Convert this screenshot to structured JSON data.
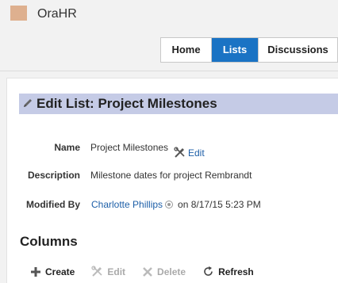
{
  "app": {
    "title": "OraHR",
    "logo_color": "#deb08f"
  },
  "nav": {
    "tabs": [
      {
        "label": "Home",
        "active": false
      },
      {
        "label": "Lists",
        "active": true
      },
      {
        "label": "Discussions",
        "active": false
      }
    ],
    "active_color": "#1a73c4"
  },
  "page": {
    "title": "Edit List: Project Milestones",
    "fields": {
      "name": {
        "label": "Name",
        "value": "Project Milestones",
        "edit_label": "Edit"
      },
      "description": {
        "label": "Description",
        "value": "Milestone dates for project Rembrandt"
      },
      "modified_by": {
        "label": "Modified By",
        "user": "Charlotte Phillips",
        "date": "on 8/17/15 5:23 PM"
      }
    }
  },
  "columns": {
    "heading": "Columns",
    "toolbar": {
      "create": "Create",
      "edit": "Edit",
      "delete": "Delete",
      "refresh": "Refresh"
    }
  }
}
